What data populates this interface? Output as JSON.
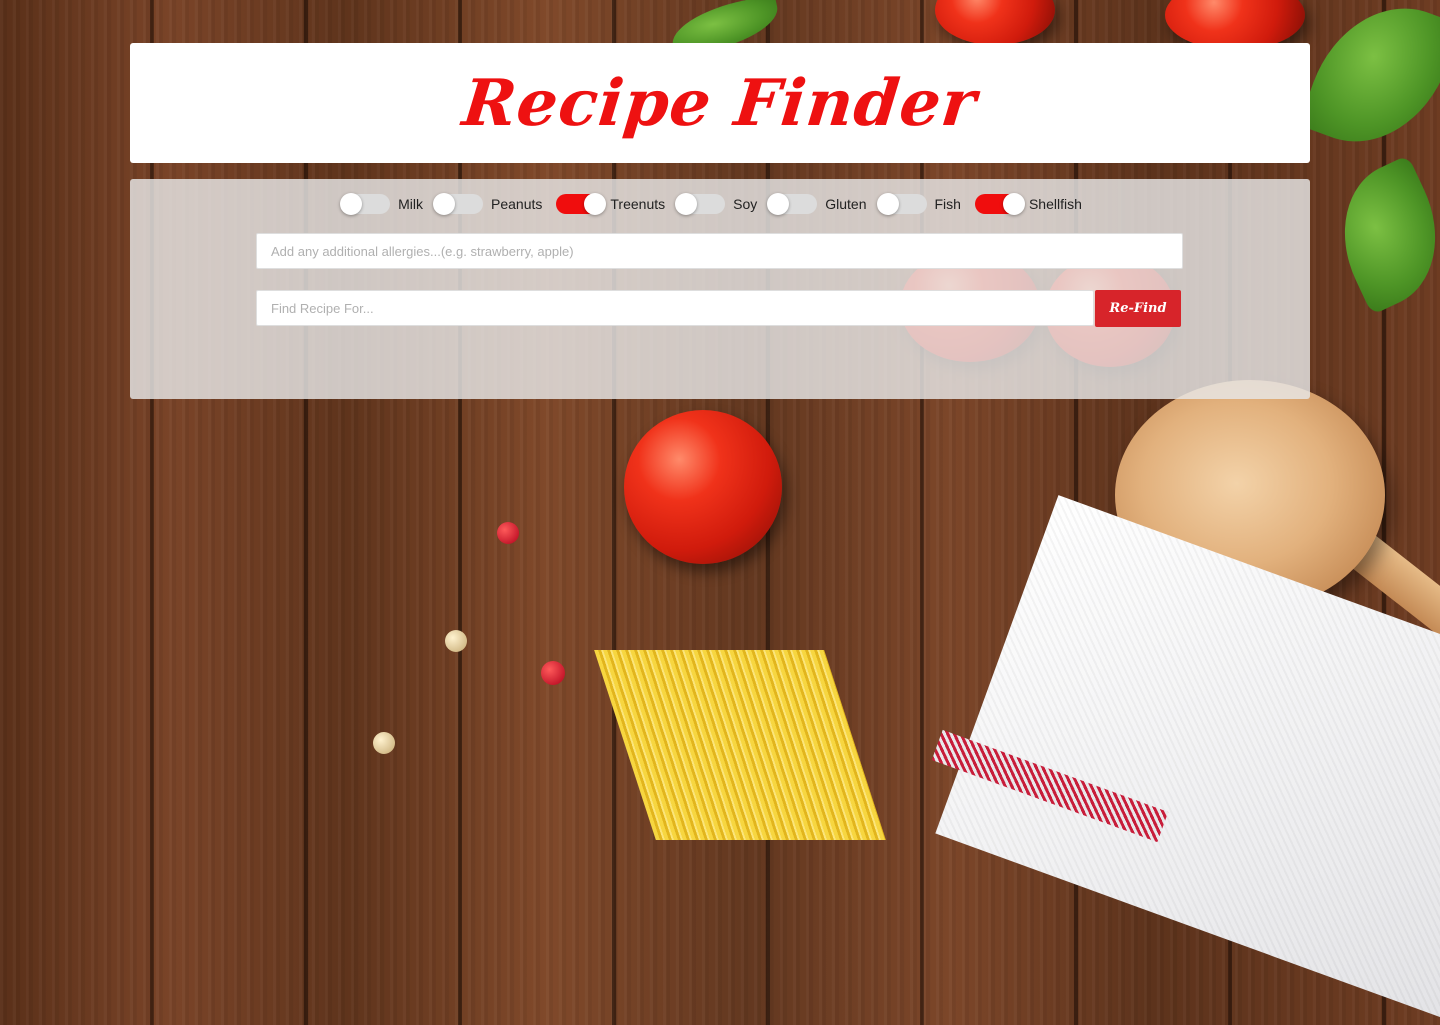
{
  "header": {
    "title": "Recipe Finder"
  },
  "allergens": [
    {
      "label": "Milk",
      "on": false
    },
    {
      "label": "Peanuts",
      "on": false
    },
    {
      "label": "Treenuts",
      "on": true
    },
    {
      "label": "Soy",
      "on": false
    },
    {
      "label": "Gluten",
      "on": false
    },
    {
      "label": "Fish",
      "on": false
    },
    {
      "label": "Shellfish",
      "on": true
    }
  ],
  "inputs": {
    "allergies_placeholder": "Add any additional allergies...(e.g. strawberry, apple)",
    "allergies_value": "",
    "search_placeholder": "Find Recipe For...",
    "search_value": ""
  },
  "buttons": {
    "refind_label": "Re-Find"
  },
  "colors": {
    "accent": "#ee1111",
    "toggle_on": "#f00d0d",
    "toggle_off": "#dcdcdc",
    "button": "#d7242a"
  }
}
